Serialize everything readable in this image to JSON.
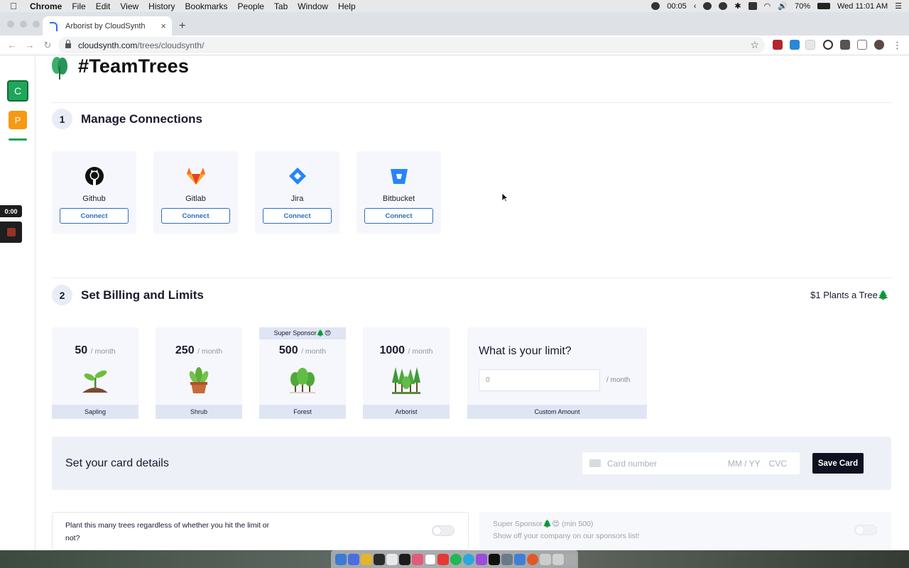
{
  "menubar": {
    "app": "Chrome",
    "items": [
      "File",
      "Edit",
      "View",
      "History",
      "Bookmarks",
      "People",
      "Tab",
      "Window",
      "Help"
    ],
    "timer": "00:05",
    "battery": "70%",
    "clock": "Wed 11:01 AM"
  },
  "browser": {
    "tab_title": "Arborist by CloudSynth",
    "url_host": "cloudsynth.com",
    "url_path": "/trees/cloudsynth/"
  },
  "rail": {
    "workspace_c": "C",
    "workspace_p": "P",
    "rec_time": "0:00"
  },
  "page": {
    "title": "#TeamTrees"
  },
  "step1": {
    "number": "1",
    "title": "Manage Connections",
    "connections": [
      {
        "name": "Github",
        "button": "Connect",
        "icon": "github-icon"
      },
      {
        "name": "Gitlab",
        "button": "Connect",
        "icon": "gitlab-icon"
      },
      {
        "name": "Jira",
        "button": "Connect",
        "icon": "jira-icon"
      },
      {
        "name": "Bitbucket",
        "button": "Connect",
        "icon": "bitbucket-icon"
      }
    ]
  },
  "step2": {
    "number": "2",
    "title": "Set Billing and Limits",
    "note": "$1 Plants a Tree🌲",
    "tiers": [
      {
        "amount": "50",
        "per": "/ month",
        "label": "Sapling"
      },
      {
        "amount": "250",
        "per": "/ month",
        "label": "Shrub"
      },
      {
        "amount": "500",
        "per": "/ month",
        "label": "Forest",
        "badge": "Super Sponsor🌲😍"
      },
      {
        "amount": "1000",
        "per": "/ month",
        "label": "Arborist"
      }
    ],
    "custom": {
      "question": "What is your limit?",
      "value": "0",
      "per": "/ month",
      "label": "Custom Amount"
    }
  },
  "card": {
    "label": "Set your card details",
    "number_placeholder": "Card number",
    "expiry_placeholder": "MM / YY",
    "cvc_placeholder": "CVC",
    "save": "Save Card"
  },
  "options": {
    "plant_regardless": "Plant this many trees regardless of whether you hit the limit or not?",
    "sponsor_title": "Super Sponsor🌲😍 (min 500)",
    "sponsor_desc": "Show off your company on our sponsors list!"
  },
  "colors": {
    "brand_green": "#1ea65a",
    "link_blue": "#2f6fba",
    "dark_button": "#0f1020"
  }
}
